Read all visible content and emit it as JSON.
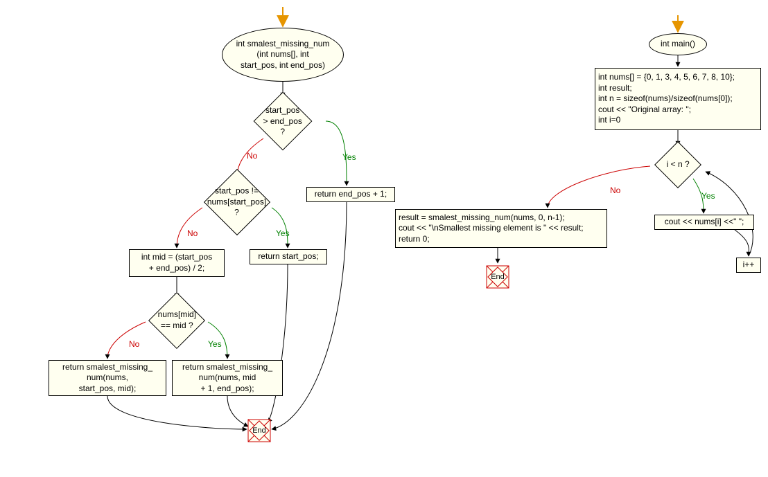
{
  "flowchart_left": {
    "fn_signature_l1": "int smalest_missing_num",
    "fn_signature_l2": "(int nums[], int",
    "fn_signature_l3": "start_pos, int end_pos)",
    "cond1": "start_pos > end_pos ?",
    "cond2_l1": "start_pos !=",
    "cond2_l2": "nums[start_pos] ?",
    "ret_endpos": "return end_pos + 1;",
    "ret_startpos": "return start_pos;",
    "mid_calc_l1": "int mid = (start_pos",
    "mid_calc_l2": "+ end_pos) / 2;",
    "cond3": "nums[mid] == mid ?",
    "recurse_left_l1": "return smalest_missing_",
    "recurse_left_l2": "num(nums,",
    "recurse_left_l3": "start_pos, mid);",
    "recurse_right_l1": "return smalest_missing_",
    "recurse_right_l2": "num(nums, mid",
    "recurse_right_l3": "+ 1, end_pos);",
    "end": "End"
  },
  "flowchart_right": {
    "fn_signature": "int main()",
    "init_l1": "int nums[] = {0, 1, 3, 4, 5, 6, 7, 8, 10};",
    "init_l2": "int result;",
    "init_l3": "int n = sizeof(nums)/sizeof(nums[0]);",
    "init_l4": "cout << \"Original array: \";",
    "init_l5": "int i=0",
    "cond_loop": "i < n ?",
    "loop_body": "cout << nums[i] <<\" \";",
    "loop_inc": "i++",
    "after_l1": "result = smalest_missing_num(nums, 0, n-1);",
    "after_l2": "cout << \"\\nSmallest missing element is \" << result;",
    "after_l3": "return 0;",
    "end": "End"
  },
  "labels": {
    "yes": "Yes",
    "no": "No"
  },
  "chart_data": {
    "type": "flowchart",
    "functions": [
      {
        "name": "smalest_missing_num",
        "signature": "int smalest_missing_num(int nums[], int start_pos, int end_pos)",
        "nodes": [
          {
            "id": "start",
            "type": "start-arrow"
          },
          {
            "id": "sig",
            "type": "ellipse",
            "text": "int smalest_missing_num (int nums[], int start_pos, int end_pos)"
          },
          {
            "id": "c1",
            "type": "decision",
            "text": "start_pos > end_pos ?"
          },
          {
            "id": "r1",
            "type": "process",
            "text": "return end_pos + 1;"
          },
          {
            "id": "c2",
            "type": "decision",
            "text": "start_pos != nums[start_pos] ?"
          },
          {
            "id": "r2",
            "type": "process",
            "text": "return start_pos;"
          },
          {
            "id": "p_mid",
            "type": "process",
            "text": "int mid = (start_pos + end_pos) / 2;"
          },
          {
            "id": "c3",
            "type": "decision",
            "text": "nums[mid] == mid ?"
          },
          {
            "id": "r3",
            "type": "process",
            "text": "return smalest_missing_num(nums, mid + 1, end_pos);"
          },
          {
            "id": "r4",
            "type": "process",
            "text": "return smalest_missing_num(nums, start_pos, mid);"
          },
          {
            "id": "end",
            "type": "terminator",
            "text": "End"
          }
        ],
        "edges": [
          {
            "from": "start",
            "to": "sig"
          },
          {
            "from": "sig",
            "to": "c1"
          },
          {
            "from": "c1",
            "to": "r1",
            "label": "Yes"
          },
          {
            "from": "c1",
            "to": "c2",
            "label": "No"
          },
          {
            "from": "c2",
            "to": "r2",
            "label": "Yes"
          },
          {
            "from": "c2",
            "to": "p_mid",
            "label": "No"
          },
          {
            "from": "p_mid",
            "to": "c3"
          },
          {
            "from": "c3",
            "to": "r3",
            "label": "Yes"
          },
          {
            "from": "c3",
            "to": "r4",
            "label": "No"
          },
          {
            "from": "r1",
            "to": "end"
          },
          {
            "from": "r2",
            "to": "end"
          },
          {
            "from": "r3",
            "to": "end"
          },
          {
            "from": "r4",
            "to": "end"
          }
        ]
      },
      {
        "name": "main",
        "signature": "int main()",
        "nodes": [
          {
            "id": "mstart",
            "type": "start-arrow"
          },
          {
            "id": "msig",
            "type": "ellipse",
            "text": "int main()"
          },
          {
            "id": "minit",
            "type": "process",
            "text": "int nums[] = {0, 1, 3, 4, 5, 6, 7, 8, 10}; int result; int n = sizeof(nums)/sizeof(nums[0]); cout << \"Original array: \"; int i=0"
          },
          {
            "id": "mcond",
            "type": "decision",
            "text": "i < n ?"
          },
          {
            "id": "mbody",
            "type": "process",
            "text": "cout << nums[i] <<\" \";"
          },
          {
            "id": "minc",
            "type": "process",
            "text": "i++"
          },
          {
            "id": "mafter",
            "type": "process",
            "text": "result = smalest_missing_num(nums, 0, n-1); cout << \"\\nSmallest missing element is \" << result; return 0;"
          },
          {
            "id": "mend",
            "type": "terminator",
            "text": "End"
          }
        ],
        "edges": [
          {
            "from": "mstart",
            "to": "msig"
          },
          {
            "from": "msig",
            "to": "minit"
          },
          {
            "from": "minit",
            "to": "mcond"
          },
          {
            "from": "mcond",
            "to": "mbody",
            "label": "Yes"
          },
          {
            "from": "mbody",
            "to": "minc"
          },
          {
            "from": "minc",
            "to": "mcond"
          },
          {
            "from": "mcond",
            "to": "mafter",
            "label": "No"
          },
          {
            "from": "mafter",
            "to": "mend"
          }
        ]
      }
    ]
  }
}
